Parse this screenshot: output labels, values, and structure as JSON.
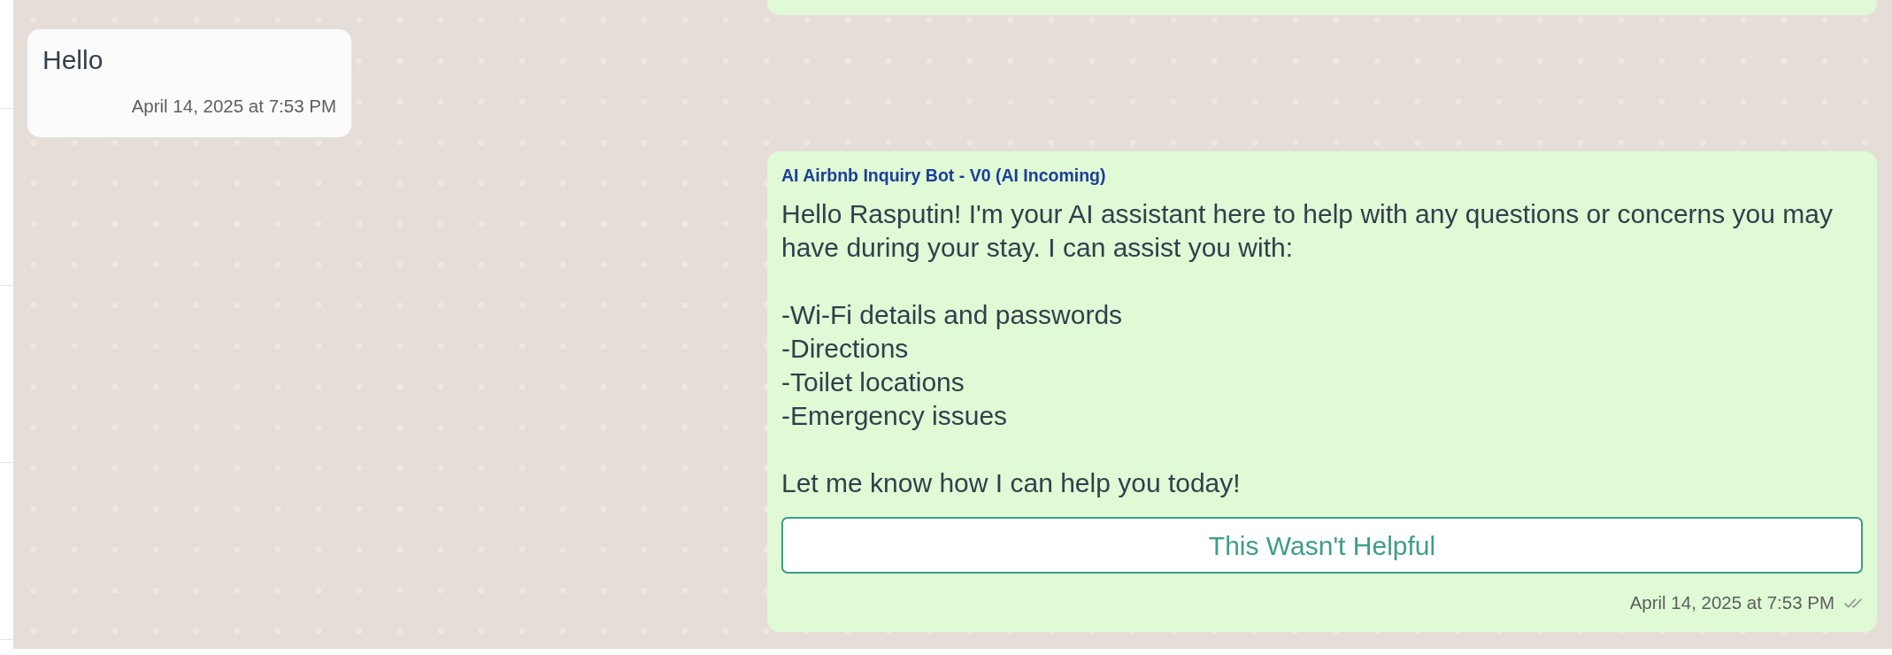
{
  "conversation": {
    "messages": [
      {
        "outgoing": true
      },
      {
        "outgoing": false,
        "body": [
          {
            "kind": "paragraph",
            "text": "Hello"
          }
        ],
        "time": "April 14, 2025 at 7:53 PM"
      },
      {
        "outgoing": true,
        "sender": "AI Airbnb Inquiry Bot - V0 (AI Incoming)",
        "body": [
          {
            "kind": "paragraph",
            "text": "Hello Rasputin! I'm your AI assistant here to help with any questions or concerns you may have during your stay. I can assist you with:"
          },
          {
            "kind": "list",
            "items": [
              "-Wi-Fi details and passwords",
              "-Directions",
              "-Toilet locations",
              "-Emergency issues"
            ]
          },
          {
            "kind": "paragraph",
            "text": "Let me know how I can help you today!"
          }
        ],
        "button": {
          "label": "This Wasn't Helpful"
        },
        "time": "April 14, 2025 at 7:53 PM",
        "read": false
      }
    ]
  }
}
